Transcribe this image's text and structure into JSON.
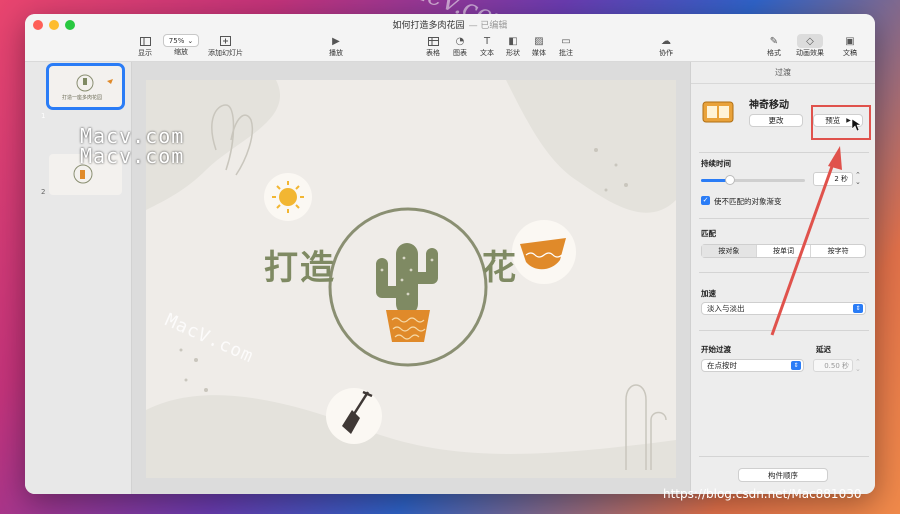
{
  "watermarks": {
    "macv_top": "Macv.com",
    "macv_bottom": "Macv.com",
    "macv_diag": "MacV.com",
    "url": "https://blog.csdn.net/Mac881030"
  },
  "window": {
    "title": "如何打造多肉花园",
    "edited": "— 已编辑"
  },
  "toolbar": {
    "view": "显示",
    "zoom_value": "75%",
    "zoom": "缩放",
    "add_slide": "添加幻灯片",
    "play": "播放",
    "table": "表格",
    "chart": "图表",
    "text": "文本",
    "shape": "形状",
    "media": "媒体",
    "comment": "批注",
    "collaborate": "协作",
    "format": "格式",
    "animate": "动画效果",
    "document": "文稿"
  },
  "slides": [
    {
      "num": "1",
      "title": "打造一座多肉花园"
    },
    {
      "num": "2"
    }
  ],
  "slide": {
    "title_left": "打造",
    "title_right": "花"
  },
  "inspector": {
    "header": "过渡",
    "effect_name": "神奇移动",
    "change_button": "更改",
    "preview_button": "预览",
    "duration_label": "持续时间",
    "duration_value": "2 秒",
    "fade_checkbox": "使不匹配的对象渐变",
    "match_label": "匹配",
    "match_options": [
      "按对象",
      "按单词",
      "按字符"
    ],
    "accel_label": "加速",
    "accel_value": "淡入与淡出",
    "start_label": "开始过渡",
    "start_value": "在点按时",
    "delay_label": "延迟",
    "delay_value": "0.50 秒",
    "build_order_button": "构件顺序"
  },
  "colors": {
    "accent": "#2a7cf6",
    "highlight_box": "#e0524c",
    "cactus": "#7f8a63",
    "pot": "#e08a2a"
  }
}
